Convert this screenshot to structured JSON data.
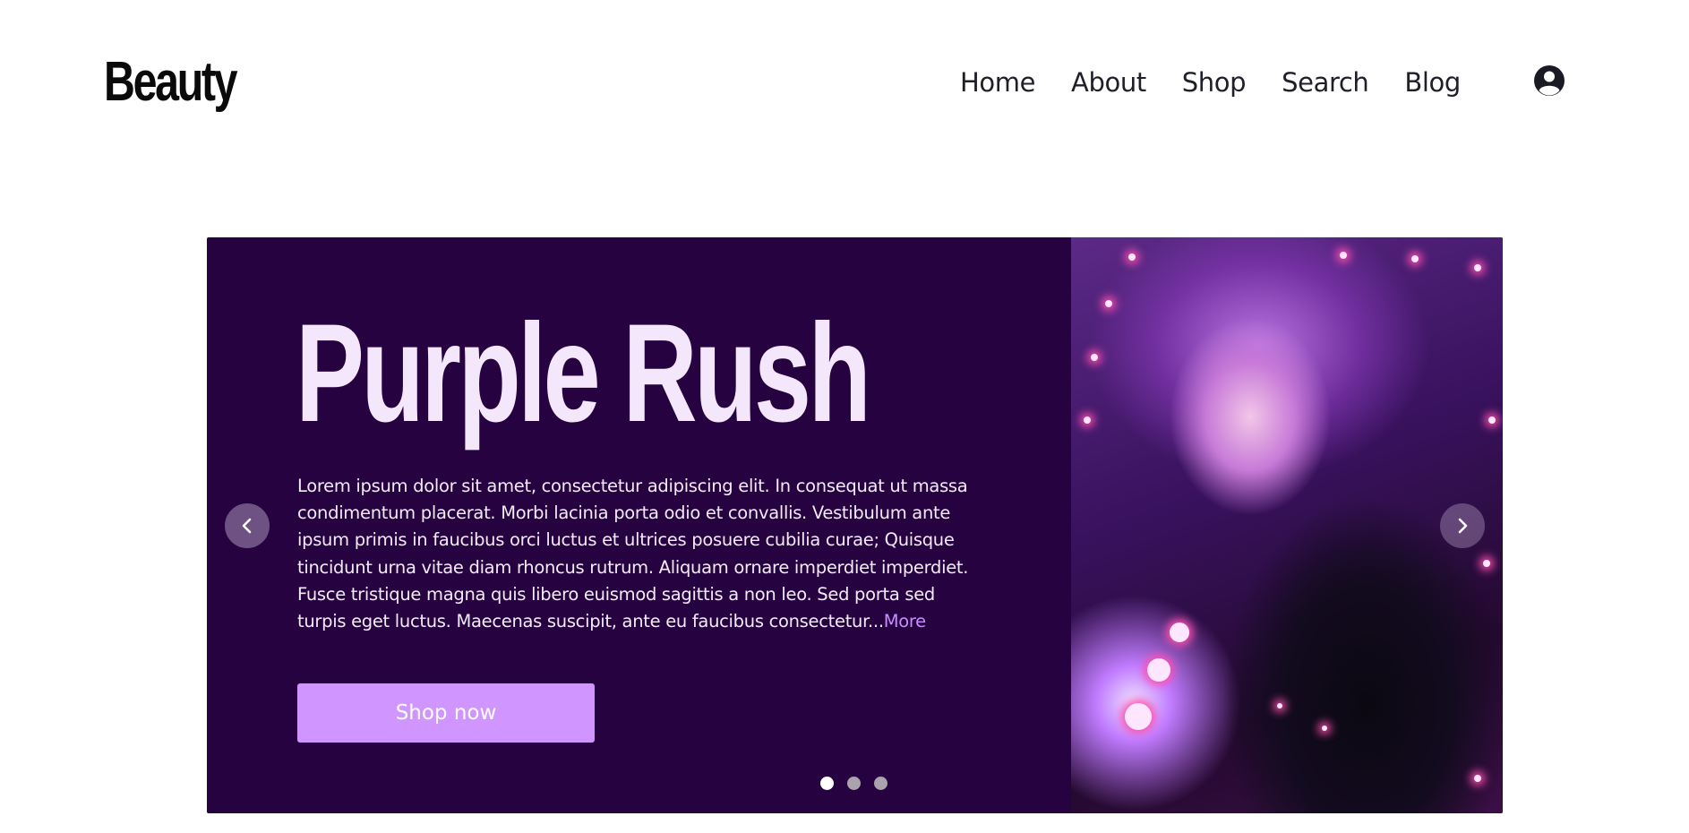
{
  "header": {
    "logo": "Beauty",
    "nav": [
      {
        "label": "Home"
      },
      {
        "label": "About"
      },
      {
        "label": "Shop"
      },
      {
        "label": "Search"
      },
      {
        "label": "Blog"
      }
    ],
    "account_icon": "user-circle-icon"
  },
  "hero": {
    "title": "Purple Rush",
    "body": "Lorem ipsum dolor sit amet, consectetur adipiscing elit. In consequat ut massa condimentum placerat. Morbi lacinia porta odio et convallis. Vestibulum ante ipsum primis in faucibus orci luctus et ultrices posuere cubilia curae; Quisque tincidunt urna vitae diam rhoncus rutrum. Aliquam ornare imperdiet imperdiet. Fusce tristique magna quis libero euismod sagittis a non leo. Sed porta sed turpis eget luctus. Maecenas suscipit, ante eu faucibus consectetur...",
    "more_label": "More",
    "cta_label": "Shop now",
    "prev_icon": "chevron-left-icon",
    "next_icon": "chevron-right-icon",
    "slide_count": 3,
    "active_slide": 1,
    "colors": {
      "background": "#260340",
      "title": "#f5e7fb",
      "accent": "#d195ff",
      "link": "#c98cff"
    }
  }
}
